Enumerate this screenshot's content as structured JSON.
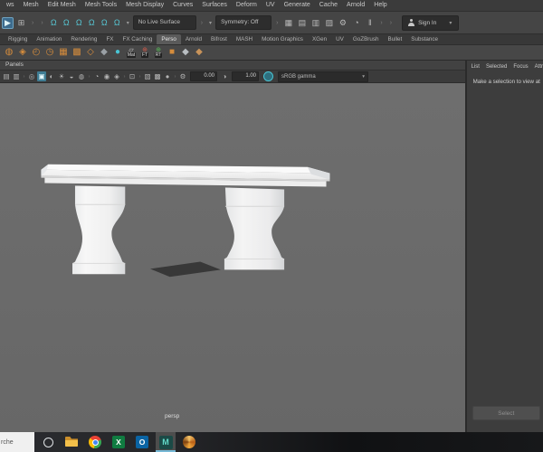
{
  "colors": {
    "accent_teal": "#49c4d4",
    "shelf_orange": "#d58c3c",
    "viewport_bg": "#6a6a6a",
    "highlight_blue": "#3c6b8d"
  },
  "menu_bar": {
    "items": [
      "ws",
      "Mesh",
      "Edit Mesh",
      "Mesh Tools",
      "Mesh Display",
      "Curves",
      "Surfaces",
      "Deform",
      "UV",
      "Generate",
      "Cache",
      "Arnold",
      "Help"
    ]
  },
  "status_line": {
    "mode_icons": [
      {
        "name": "select-tool-icon",
        "glyph": "▶",
        "active": true
      },
      {
        "name": "component-mode-icon",
        "glyph": "⊞"
      }
    ],
    "snap_icons": [
      {
        "name": "snap-to-grid-icon",
        "glyph": "Ω"
      },
      {
        "name": "snap-to-curve-icon",
        "glyph": "Ω"
      },
      {
        "name": "snap-to-point-icon",
        "glyph": "Ω"
      },
      {
        "name": "snap-to-projected-center-icon",
        "glyph": "Ω"
      },
      {
        "name": "snap-to-view-plane-icon",
        "glyph": "Ω"
      },
      {
        "name": "make-live-icon",
        "glyph": "Ω"
      }
    ],
    "live_surface_label": "No Live Surface",
    "symmetry_label": "Symmetry: Off",
    "render_icons": [
      {
        "name": "render-view-icon",
        "glyph": "▦"
      },
      {
        "name": "quick-render-icon",
        "glyph": "▤"
      },
      {
        "name": "ipr-render-icon",
        "glyph": "▥"
      },
      {
        "name": "render-settings-icon",
        "glyph": "▨"
      },
      {
        "name": "hypershade-icon",
        "glyph": "⚙"
      },
      {
        "name": "arnold-renderview-icon",
        "glyph": "◔"
      },
      {
        "name": "pause-viewport-icon",
        "glyph": "‖"
      }
    ],
    "sign_in_label": "Sign In"
  },
  "shelf": {
    "tabs": [
      {
        "label": "Rigging"
      },
      {
        "label": "Animation"
      },
      {
        "label": "Rendering"
      },
      {
        "label": "FX"
      },
      {
        "label": "FX Caching"
      },
      {
        "label": "Perso",
        "active": true
      },
      {
        "label": "Arnold"
      },
      {
        "label": "Bifrost"
      },
      {
        "label": "MASH"
      },
      {
        "label": "Motion Graphics"
      },
      {
        "label": "XGen"
      },
      {
        "label": "UV"
      },
      {
        "label": "GoZBrush"
      },
      {
        "label": "Bullet"
      },
      {
        "label": "Substance"
      }
    ],
    "icons": [
      {
        "name": "poly-sphere-icon",
        "glyph": "◍",
        "color": "#d58c3c"
      },
      {
        "name": "poly-stack-icon",
        "glyph": "◈",
        "color": "#d58c3c"
      },
      {
        "name": "smooth-mesh-icon",
        "glyph": "◴",
        "color": "#d58c3c"
      },
      {
        "name": "subdiv-toggle-icon",
        "glyph": "◷",
        "color": "#d58c3c"
      },
      {
        "name": "grid-quads-icon",
        "glyph": "▦",
        "color": "#d58c3c"
      },
      {
        "name": "grid-cube-icon",
        "glyph": "▩",
        "color": "#d58c3c"
      },
      {
        "name": "quad-draw-icon",
        "glyph": "◇",
        "color": "#d58c3c"
      },
      {
        "name": "flat-plane-icon",
        "glyph": "◆",
        "color": "#9aa0a5"
      },
      {
        "name": "sculpt-sphere-icon",
        "glyph": "●",
        "color": "#49c4d4"
      },
      {
        "name": "material-editor-icon",
        "glyph": "▱",
        "color": "#d8d8d8",
        "label": "Mat"
      },
      {
        "name": "freeze-transform-icon",
        "glyph": "⊕",
        "color": "#cf5a4a",
        "label": "FT"
      },
      {
        "name": "reset-transform-icon",
        "glyph": "⊕",
        "color": "#58b858",
        "label": "RT"
      },
      {
        "name": "poly-cube-icon",
        "glyph": "■",
        "color": "#d58c3c"
      },
      {
        "name": "ground-plane-icon",
        "glyph": "◆",
        "color": "#b9bec2"
      },
      {
        "name": "ramp-plane-icon",
        "glyph": "◆",
        "color": "#c8935a"
      }
    ]
  },
  "viewport": {
    "panels_menu_label": "Panels",
    "toolbar_icons": [
      {
        "name": "camera-attrs-icon",
        "glyph": "▤"
      },
      {
        "name": "bookmarks-icon",
        "glyph": "▥"
      },
      {
        "name": "separator",
        "glyph": "›",
        "sep": true
      },
      {
        "name": "image-plane-icon",
        "glyph": "◎"
      },
      {
        "name": "shaded-mode-icon",
        "glyph": "▣",
        "active": true
      },
      {
        "name": "textured-mode-icon",
        "glyph": "◐"
      },
      {
        "name": "lighting-icon",
        "glyph": "☀"
      },
      {
        "name": "shadows-icon",
        "glyph": "◒"
      },
      {
        "name": "ambient-occlusion-icon",
        "glyph": "◍"
      },
      {
        "name": "separator",
        "glyph": "›",
        "sep": true
      },
      {
        "name": "motion-blur-icon",
        "glyph": "◔"
      },
      {
        "name": "multisampling-icon",
        "glyph": "◉"
      },
      {
        "name": "depth-of-field-icon",
        "glyph": "◈"
      },
      {
        "name": "separator",
        "glyph": "›",
        "sep": true
      },
      {
        "name": "isolate-select-icon",
        "glyph": "⊡"
      },
      {
        "name": "separator",
        "glyph": "›",
        "sep": true
      },
      {
        "name": "xray-icon",
        "glyph": "▧"
      },
      {
        "name": "wireframe-on-shaded-icon",
        "glyph": "▩"
      },
      {
        "name": "default-material-icon",
        "glyph": "●"
      },
      {
        "name": "separator",
        "glyph": "›",
        "sep": true
      },
      {
        "name": "exposure-icon",
        "glyph": "⚙"
      }
    ],
    "exposure_value": "0.00",
    "gamma_icon_glyph": "◑",
    "gamma_value": "1.00",
    "gamma_label": "sRGB gamma",
    "camera_label": "persp"
  },
  "attribute_editor": {
    "menu_items": [
      "List",
      "Selected",
      "Focus",
      "Attr"
    ],
    "placeholder_message": "Make a selection to view at",
    "select_button_label": "Select"
  },
  "taskbar": {
    "search_text": "rche",
    "icons": [
      {
        "name": "cortana-icon",
        "kind": "cortana"
      },
      {
        "name": "file-explorer-icon",
        "kind": "folder"
      },
      {
        "name": "chrome-icon",
        "kind": "chrome"
      },
      {
        "name": "excel-icon",
        "kind": "excel",
        "letter": "X"
      },
      {
        "name": "outlook-icon",
        "kind": "outlook",
        "letter": "O"
      },
      {
        "name": "maya-icon",
        "kind": "maya",
        "letter": "M",
        "active": true
      },
      {
        "name": "sketchbook-icon",
        "kind": "swirl"
      }
    ]
  }
}
